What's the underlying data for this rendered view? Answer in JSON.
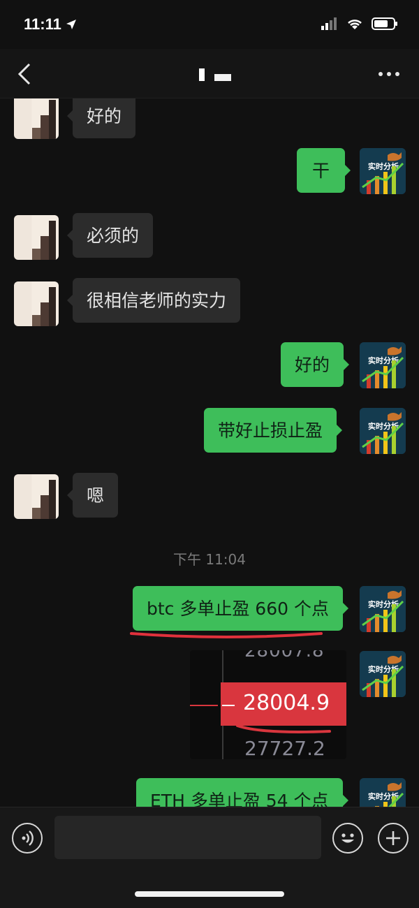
{
  "status_bar": {
    "time": "11:11"
  },
  "nav": {
    "back_icon": "chevron-left-icon",
    "more_icon": "ellipsis-icon"
  },
  "messages": [
    {
      "side": "left",
      "text": "好的"
    },
    {
      "side": "right",
      "text": "干"
    },
    {
      "side": "left",
      "text": "必须的"
    },
    {
      "side": "left",
      "text": "很相信老师的实力"
    },
    {
      "side": "right",
      "text": "好的"
    },
    {
      "side": "right",
      "text": "带好止损止盈"
    },
    {
      "side": "left",
      "text": "嗯"
    },
    {
      "type": "timestamp",
      "text": "下午 11:04"
    },
    {
      "side": "right",
      "text": "btc 多单止盈 660 个点"
    },
    {
      "side": "right",
      "type": "image",
      "price_current": "28004.9",
      "price_low": "27727.2"
    },
    {
      "side": "right",
      "text": "ETH 多单止盈 54 个点"
    }
  ],
  "avatar_teacher": {
    "caption": "实时分析",
    "accent": "#f0c419"
  },
  "colors": {
    "bubble_out": "#3ebe5a",
    "bubble_in": "#2c2c2c",
    "price_tag": "#d9363e",
    "underline": "#e0313c"
  }
}
